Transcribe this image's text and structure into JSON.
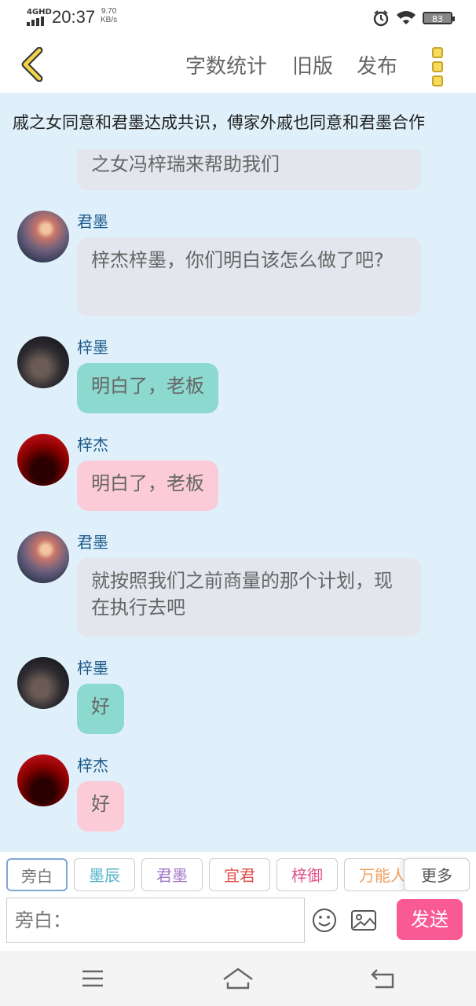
{
  "status": {
    "network": "4GHD",
    "time": "20:37",
    "speed_value": "9.70",
    "speed_unit": "KB/s",
    "battery": "83"
  },
  "topbar": {
    "word_count": "字数统计",
    "old_version": "旧版",
    "publish": "发布"
  },
  "chat_title": "戚之女同意和君墨达成共识，傅家外戚也同意和君墨合作",
  "messages": [
    {
      "type": "cut",
      "text": "之女冯梓瑞来帮助我们"
    },
    {
      "name": "君墨",
      "text": "梓杰梓墨，你们明白该怎么做了吧?"
    },
    {
      "name": "梓墨",
      "text": "明白了，老板"
    },
    {
      "name": "梓杰",
      "text": "明白了，老板"
    },
    {
      "name": "君墨",
      "text": "就按照我们之前商量的那个计划，现在执行去吧"
    },
    {
      "name": "梓墨",
      "text": "好"
    },
    {
      "name": "梓杰",
      "text": "好"
    }
  ],
  "roles": [
    {
      "label": "旁白",
      "color": "#777777"
    },
    {
      "label": "墨辰",
      "color": "#4fb3c8"
    },
    {
      "label": "君墨",
      "color": "#a277c9"
    },
    {
      "label": "宜君",
      "color": "#e0504c"
    },
    {
      "label": "梓御",
      "color": "#e0508a"
    },
    {
      "label": "万能人",
      "color": "#f0a060"
    }
  ],
  "more_label": "更多",
  "input": {
    "placeholder": "旁白："
  },
  "send_label": "发送"
}
